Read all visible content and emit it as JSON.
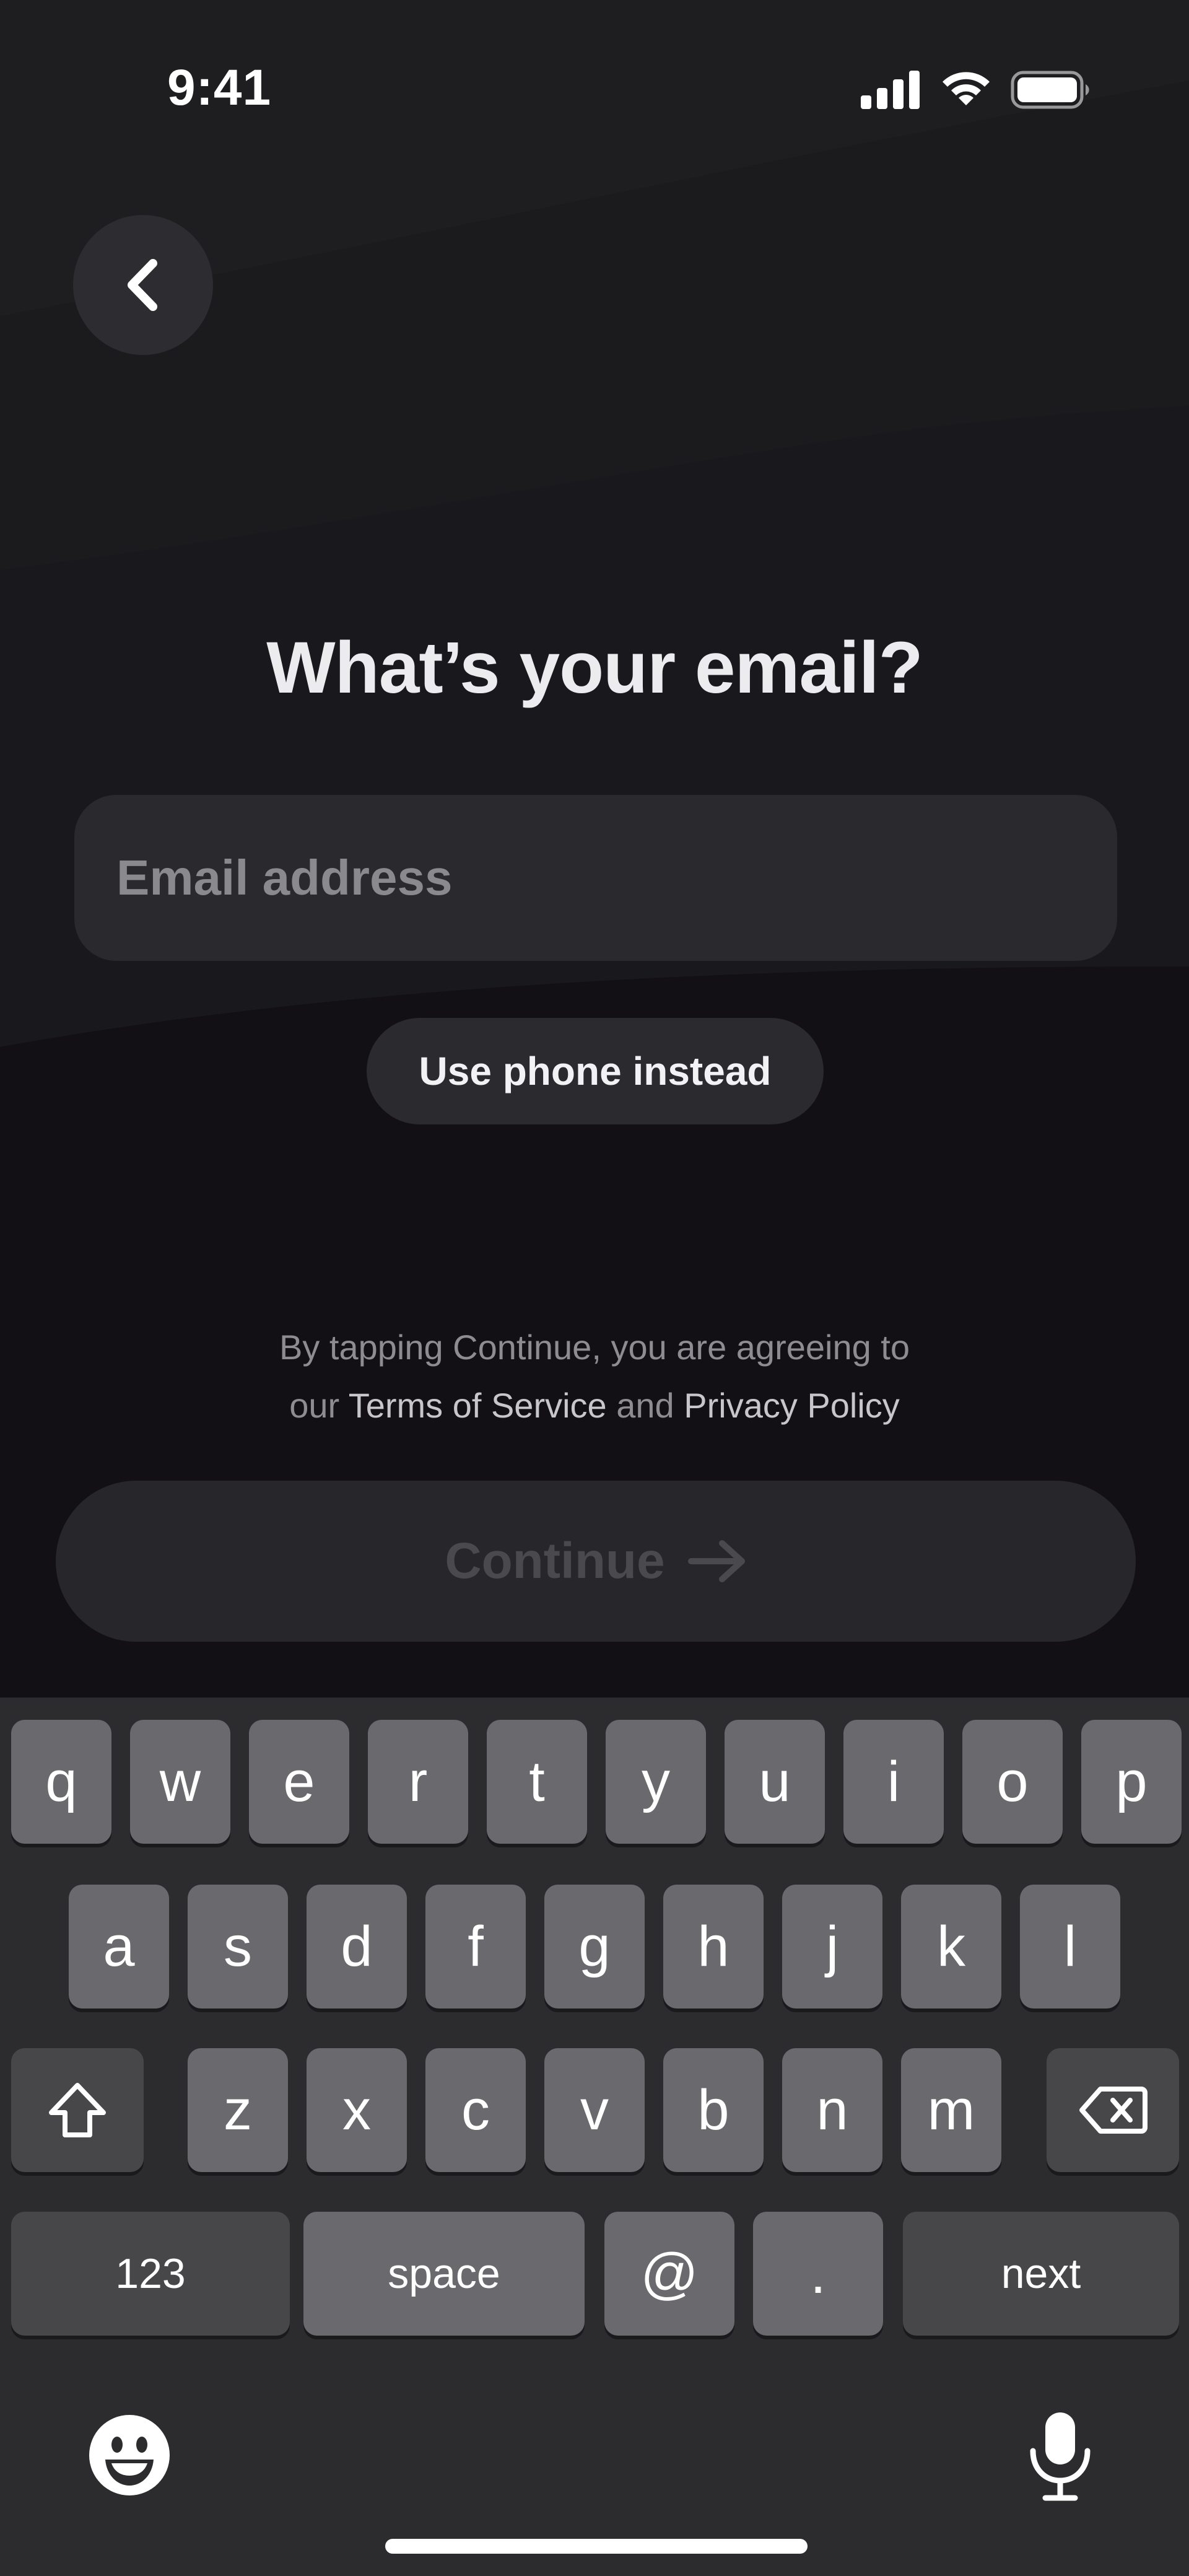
{
  "status_bar": {
    "time": "9:41",
    "icons": [
      "signal-icon",
      "wifi-icon",
      "battery-icon"
    ]
  },
  "header": {
    "back_icon": "chevron-left-icon"
  },
  "main": {
    "title": "What’s your email?",
    "email_placeholder": "Email address",
    "email_value": "",
    "alt_button_label": "Use phone instead",
    "legal": {
      "line1": "By tapping Continue, you are agreeing to",
      "prefix": "our ",
      "terms": "Terms of Service",
      "middle": " and ",
      "privacy": "Privacy Policy"
    },
    "continue_label": "Continue",
    "continue_icon": "arrow-right-icon"
  },
  "keyboard": {
    "row1": [
      "q",
      "w",
      "e",
      "r",
      "t",
      "y",
      "u",
      "i",
      "o",
      "p"
    ],
    "row2": [
      "a",
      "s",
      "d",
      "f",
      "g",
      "h",
      "j",
      "k",
      "l"
    ],
    "row3": [
      "z",
      "x",
      "c",
      "v",
      "b",
      "n",
      "m"
    ],
    "shift_icon": "shift-icon",
    "delete_icon": "backspace-icon",
    "numbers_label": "123",
    "space_label": "space",
    "at_label": "@",
    "dot_label": ".",
    "next_label": "next",
    "emoji_icon": "emoji-icon",
    "mic_icon": "microphone-icon"
  },
  "colors": {
    "background": "#131116",
    "surface": "#2a292d",
    "keyboard_bg": "#2c2c2e",
    "key": "#6a6a6e",
    "key_dark": "#474749",
    "text_primary": "#ececee",
    "text_muted": "#8e8c93"
  }
}
